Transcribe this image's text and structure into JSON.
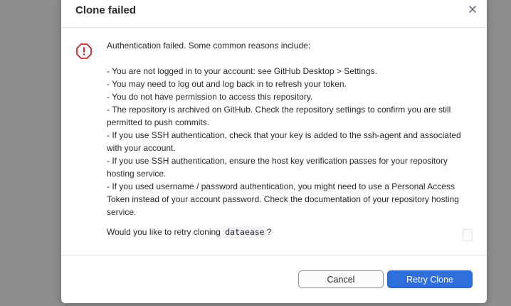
{
  "dialog": {
    "title": "Clone failed",
    "close_icon": "close-icon",
    "alert_icon": "alert-octagon-icon",
    "intro": "Authentication failed. Some common reasons include:",
    "reasons": [
      "- You are not logged in to your account: see GitHub Desktop > Settings.",
      "- You may need to log out and log back in to refresh your token.",
      "- You do not have permission to access this repository.",
      "- The repository is archived on GitHub. Check the repository settings to confirm you are still permitted to push commits.",
      "- If you use SSH authentication, check that your key is added to the ssh-agent and associated with your account.",
      "- If you use SSH authentication, ensure the host key verification passes for your repository hosting service.",
      "- If you used username / password authentication, you might need to use a Personal Access Token instead of your account password. Check the documentation of your repository hosting service."
    ],
    "retry_prefix": "Would you like to retry cloning",
    "repo_name": "dataease",
    "retry_suffix": "?",
    "cancel_label": "Cancel",
    "retry_label": "Retry Clone",
    "colors": {
      "primary": "#2f6fdc",
      "alert": "#cb2431"
    }
  }
}
